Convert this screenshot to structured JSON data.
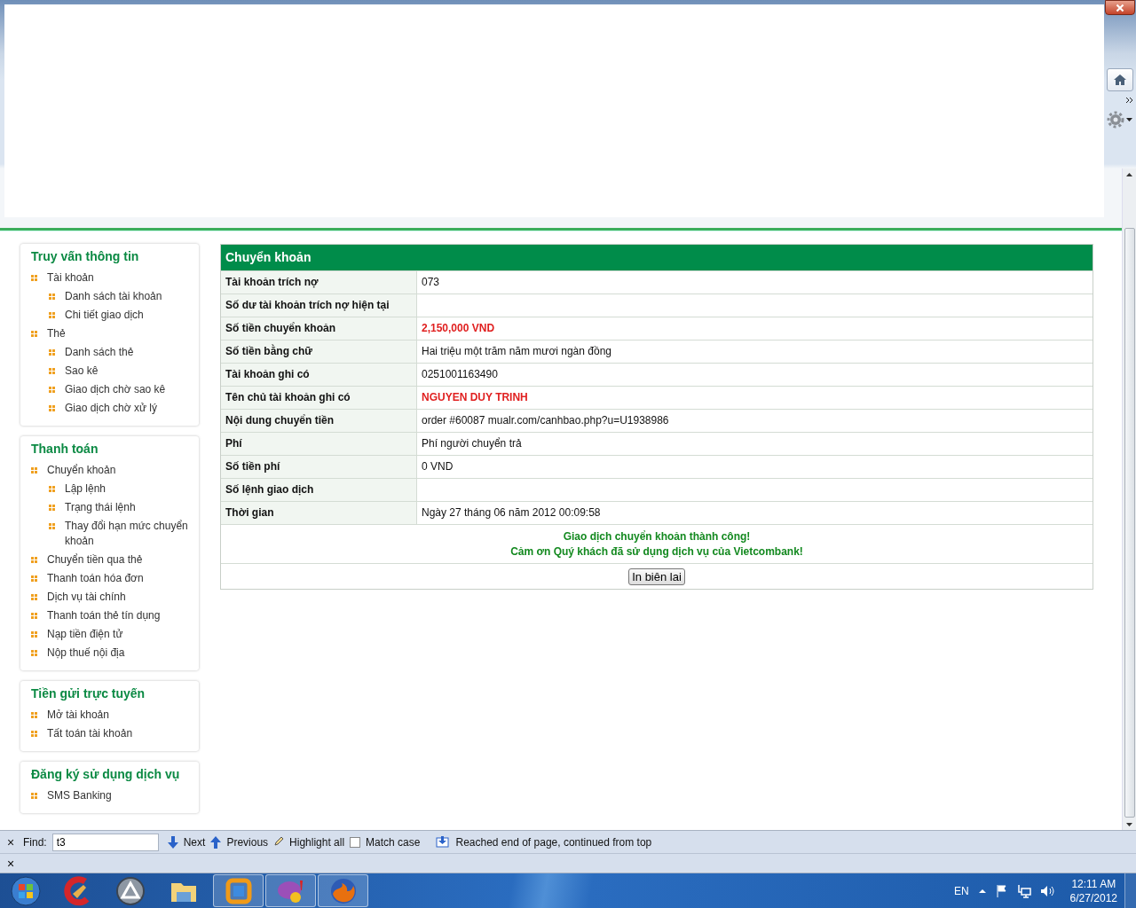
{
  "sidebar": [
    {
      "title": "Truy vấn thông tin",
      "items": [
        {
          "label": "Tài khoản",
          "children": [
            {
              "label": "Danh sách tài khoản"
            },
            {
              "label": "Chi tiết giao dịch"
            }
          ]
        },
        {
          "label": "Thẻ",
          "children": [
            {
              "label": "Danh sách thẻ"
            },
            {
              "label": "Sao kê"
            },
            {
              "label": "Giao dịch chờ sao kê"
            },
            {
              "label": "Giao dịch chờ xử lý"
            }
          ]
        }
      ]
    },
    {
      "title": "Thanh toán",
      "items": [
        {
          "label": "Chuyển khoản",
          "children": [
            {
              "label": "Lập lệnh"
            },
            {
              "label": "Trạng thái lệnh"
            },
            {
              "label": "Thay đổi hạn mức chuyển khoản"
            }
          ]
        },
        {
          "label": "Chuyển tiền qua thẻ"
        },
        {
          "label": "Thanh toán hóa đơn"
        },
        {
          "label": "Dịch vụ tài chính"
        },
        {
          "label": "Thanh toán thẻ tín dụng"
        },
        {
          "label": "Nạp tiền điện tử"
        },
        {
          "label": "Nộp thuế nội địa"
        }
      ]
    },
    {
      "title": "Tiền gửi trực tuyến",
      "items": [
        {
          "label": "Mở tài khoản"
        },
        {
          "label": "Tất toán tài khoản"
        }
      ]
    },
    {
      "title": "Đăng ký sử dụng dịch vụ",
      "items": [
        {
          "label": "SMS Banking"
        }
      ]
    }
  ],
  "transfer": {
    "title": "Chuyển khoản",
    "rows": [
      {
        "label": "Tài khoản trích nợ",
        "value": "073",
        "highlight": false
      },
      {
        "label": "Số dư tài khoản trích nợ hiện tại"
      },
      {
        "label": "Số tiền chuyển khoản",
        "value": "2,150,000 VND",
        "highlight": true
      },
      {
        "label": "Số tiền bằng chữ",
        "value": "Hai triệu một trăm năm mươi ngàn đồng",
        "highlight": false
      },
      {
        "label": "Tài khoản ghi có",
        "value": "0251001163490",
        "highlight": false
      },
      {
        "label": "Tên chủ tài khoản ghi có",
        "value": "NGUYEN DUY TRINH",
        "highlight": true
      },
      {
        "label": "Nội dung chuyển tiền",
        "value": "order #60087 mualr.com/canhbao.php?u=U1938986",
        "highlight": false
      },
      {
        "label": "Phí",
        "value": "Phí người chuyển trả",
        "highlight": false
      },
      {
        "label": "Số tiền phí",
        "value": "0 VND",
        "highlight": false
      },
      {
        "label": "Số lệnh giao dịch"
      },
      {
        "label": "Thời gian",
        "value": "Ngày 27 tháng 06 năm 2012 00:09:58",
        "highlight": false
      }
    ],
    "messages": [
      "Giao dịch chuyển khoản thành công!",
      "Cảm ơn Quý khách đã sử dụng dịch vụ của Vietcombank!"
    ],
    "print_button": "In biên lai"
  },
  "find_bar": {
    "close": "×",
    "label": "Find:",
    "value": "t3",
    "next": "Next",
    "previous": "Previous",
    "highlight_all": "Highlight all",
    "match_case": {
      "label": "Match case",
      "checked": false
    },
    "status": "Reached end of page, continued from top"
  },
  "addon_bar": {
    "close": "×"
  },
  "taskbar": {
    "apps": [
      {
        "open": false
      },
      {
        "open": false
      },
      {
        "open": false
      },
      {
        "open": true
      },
      {
        "open": true
      },
      {
        "open": true
      }
    ],
    "language": "EN",
    "time": "12:11 AM",
    "date": "6/27/2012"
  }
}
